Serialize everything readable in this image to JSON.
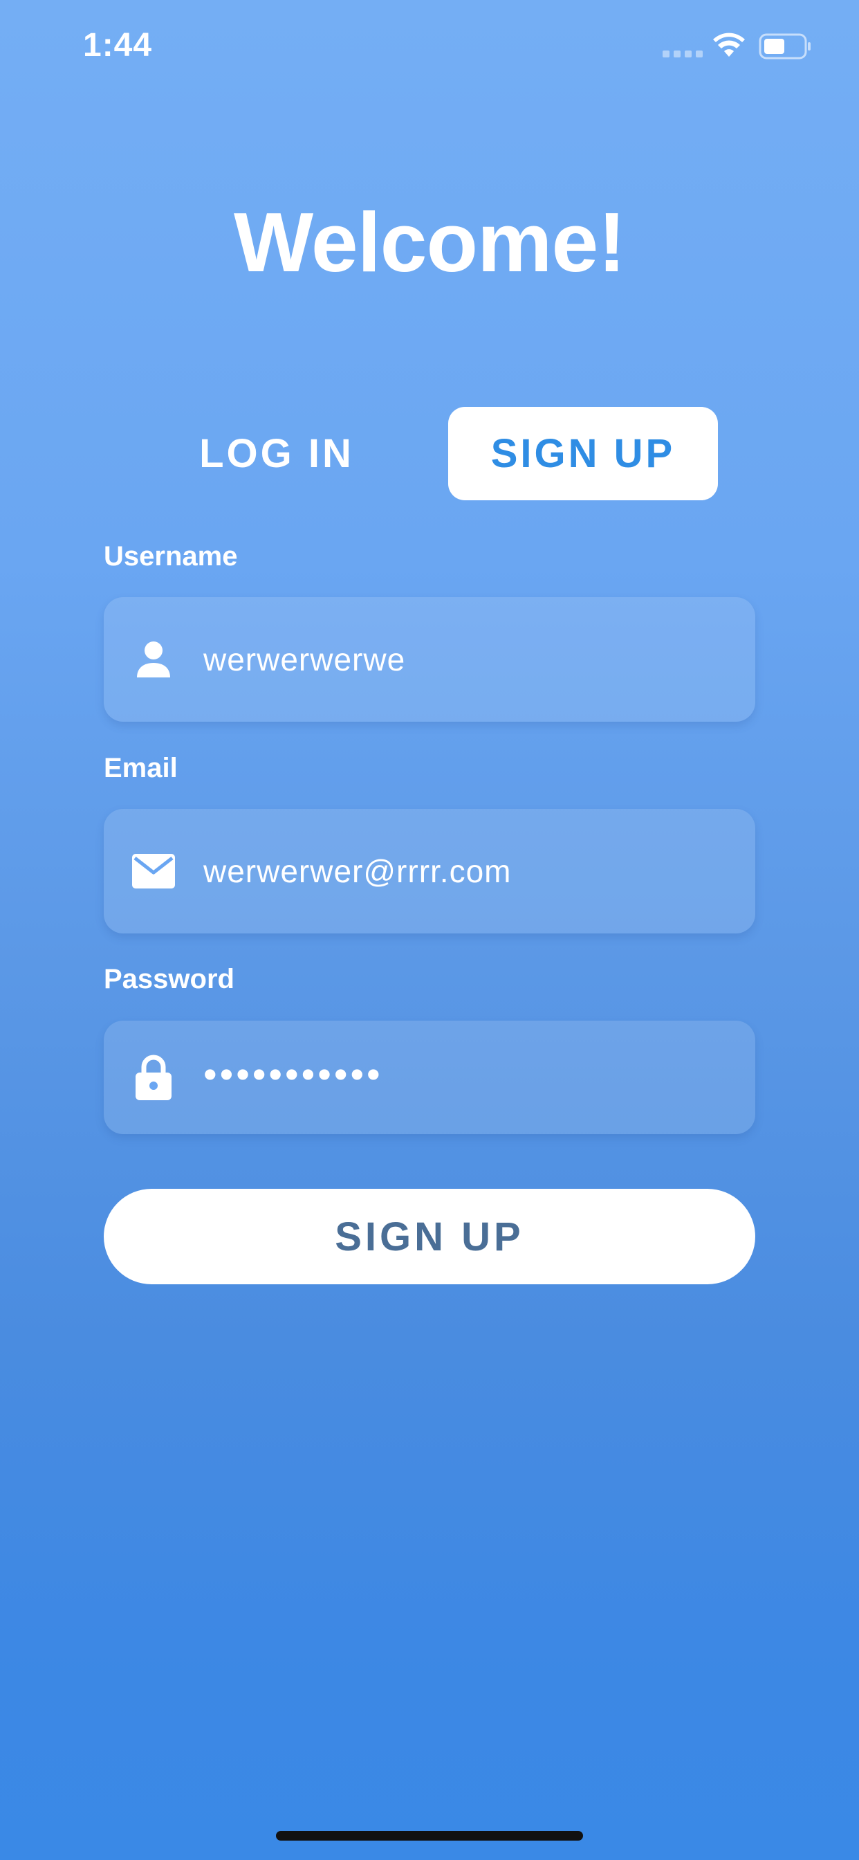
{
  "status_bar": {
    "time": "1:44",
    "signal_icon": "cellular-signal-icon",
    "wifi_icon": "wifi-icon",
    "battery_icon": "battery-icon",
    "battery_level": 0.5
  },
  "header": {
    "title": "Welcome!"
  },
  "tabs": [
    {
      "label": "LOG IN",
      "selected": false
    },
    {
      "label": "SIGN UP",
      "selected": true
    }
  ],
  "form": {
    "username": {
      "label": "Username",
      "value": "werwerwerwe",
      "icon": "user-icon"
    },
    "email": {
      "label": "Email",
      "value": "werwerwer@rrrr.com",
      "icon": "mail-icon"
    },
    "password": {
      "label": "Password",
      "value": "•••••••••••",
      "icon": "lock-icon"
    },
    "submit_label": "SIGN UP"
  },
  "colors": {
    "background_top": "#74AEF4",
    "background_bottom": "#3A89E6",
    "accent": "#2F8DE4",
    "submit_text": "#4A6E96"
  }
}
